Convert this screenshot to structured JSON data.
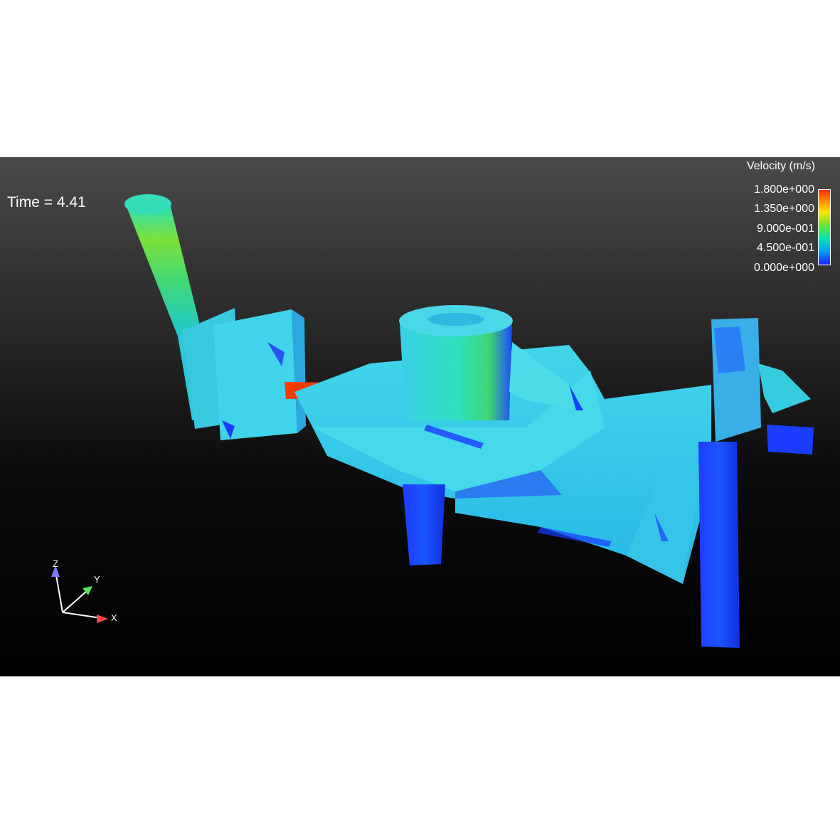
{
  "viewer": {
    "time_label": "Time = 4.41"
  },
  "legend": {
    "title": "Velocity (m/s)",
    "ticks": [
      "1.800e+000",
      "1.350e+000",
      "9.000e-001",
      "4.500e-001",
      "0.000e+000"
    ],
    "colors": [
      "#ff2a00",
      "#ffe600",
      "#64e632",
      "#00e6b4",
      "#1e1eff"
    ]
  },
  "axes": {
    "x_label": "X",
    "y_label": "Y",
    "z_label": "Z",
    "x_color": "#ff4d4d",
    "y_color": "#55e655",
    "z_color": "#7a7aff"
  }
}
